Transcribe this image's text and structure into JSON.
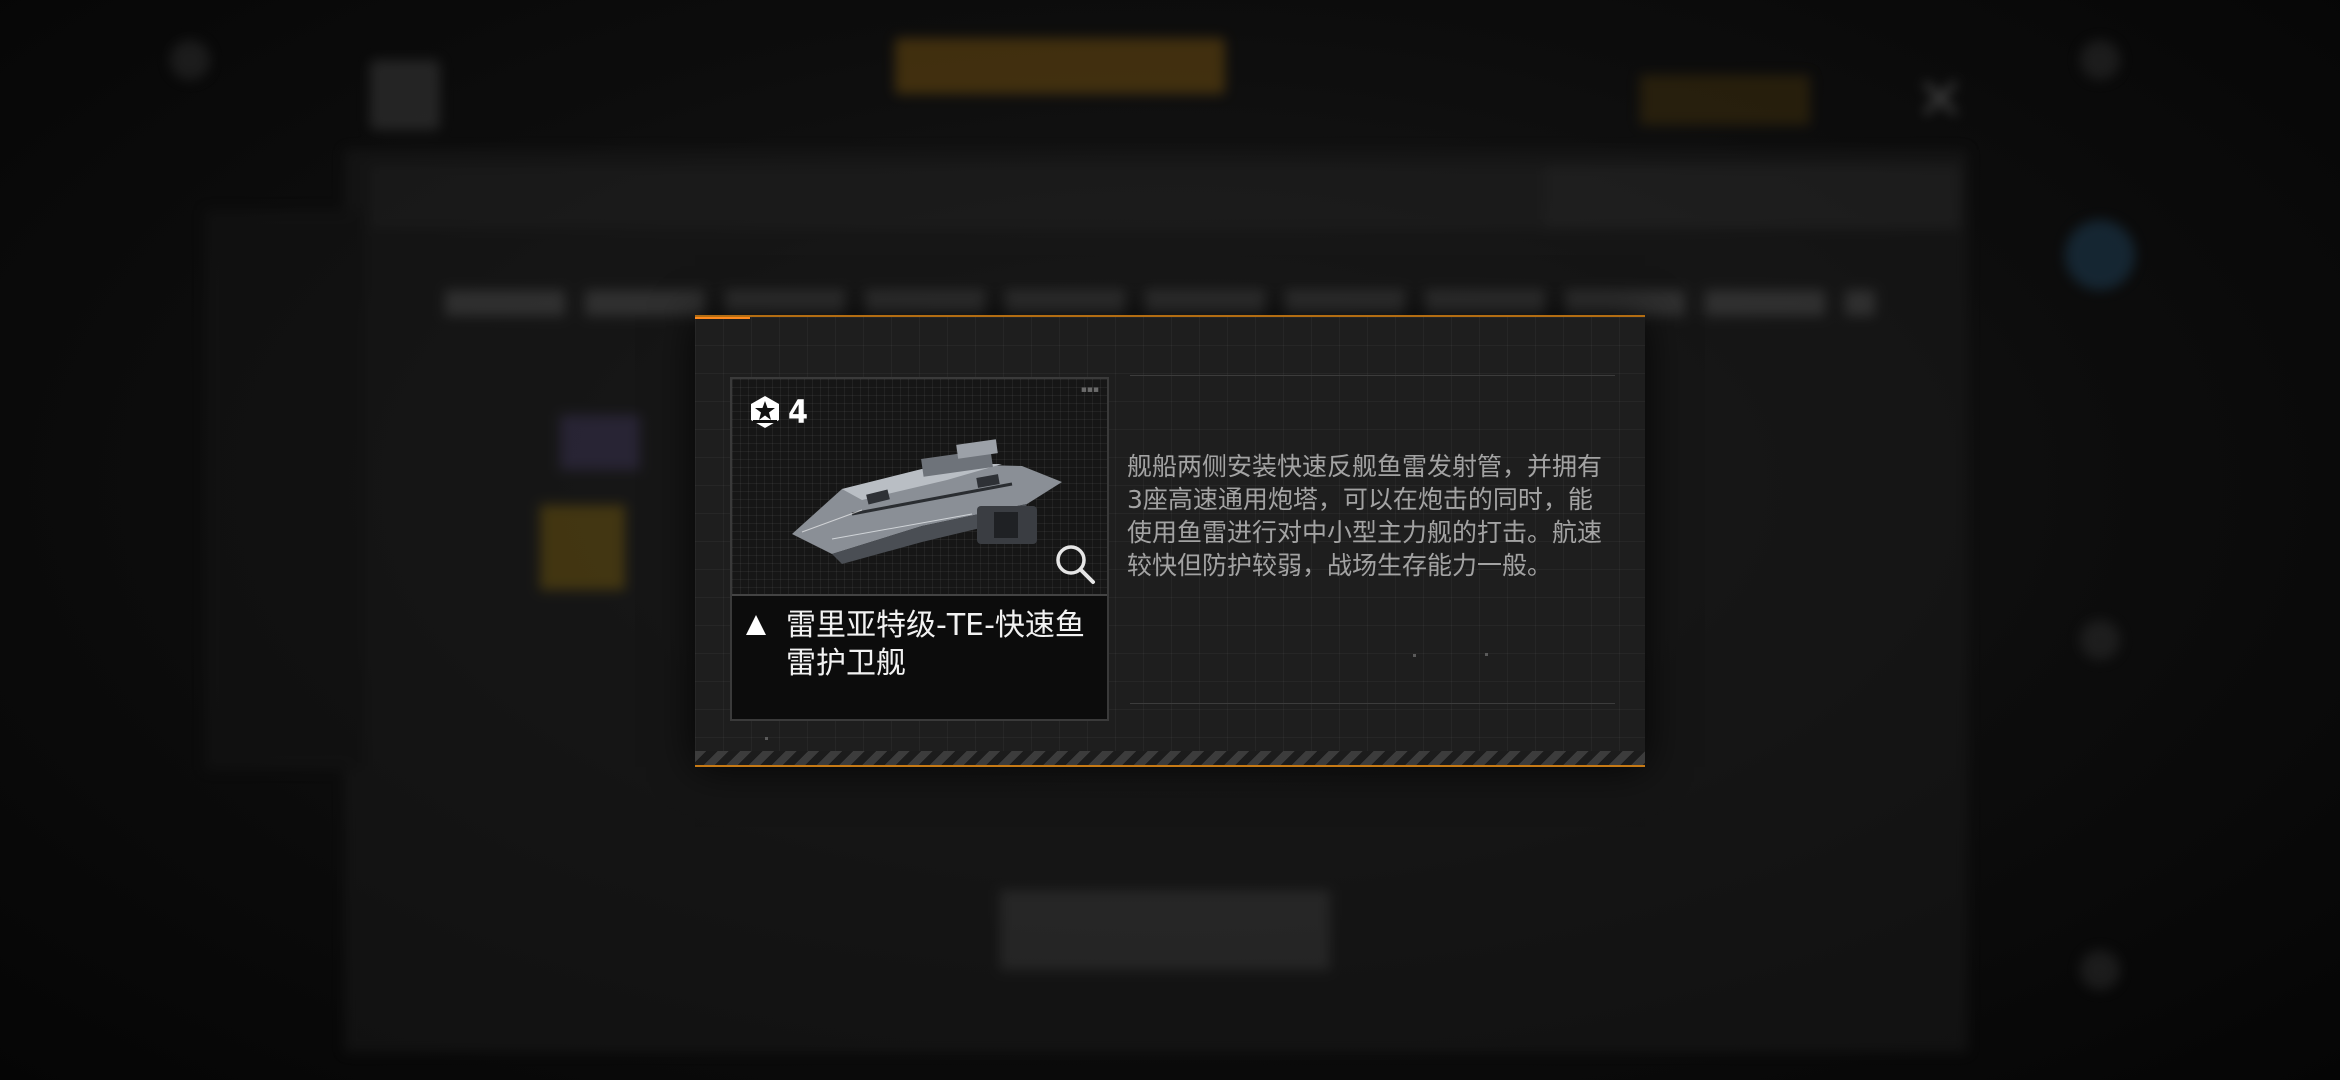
{
  "modal": {
    "tier": "4",
    "ship_name": "雷里亚特级-TE-快速鱼雷护卫舰",
    "description": "舰船两侧安装快速反舰鱼雷发射管，并拥有3座高速通用炮塔，可以在炮击的同时，能使用鱼雷进行对中小型主力舰的打击。航速较快但防护较弱，战场生存能力一般。",
    "icons": {
      "tier": "star-emblem-icon",
      "zoom": "magnify-icon",
      "ship_class": "triangle-class-icon"
    }
  },
  "colors": {
    "accent": "#ff8a1e",
    "border": "#b36d12"
  }
}
